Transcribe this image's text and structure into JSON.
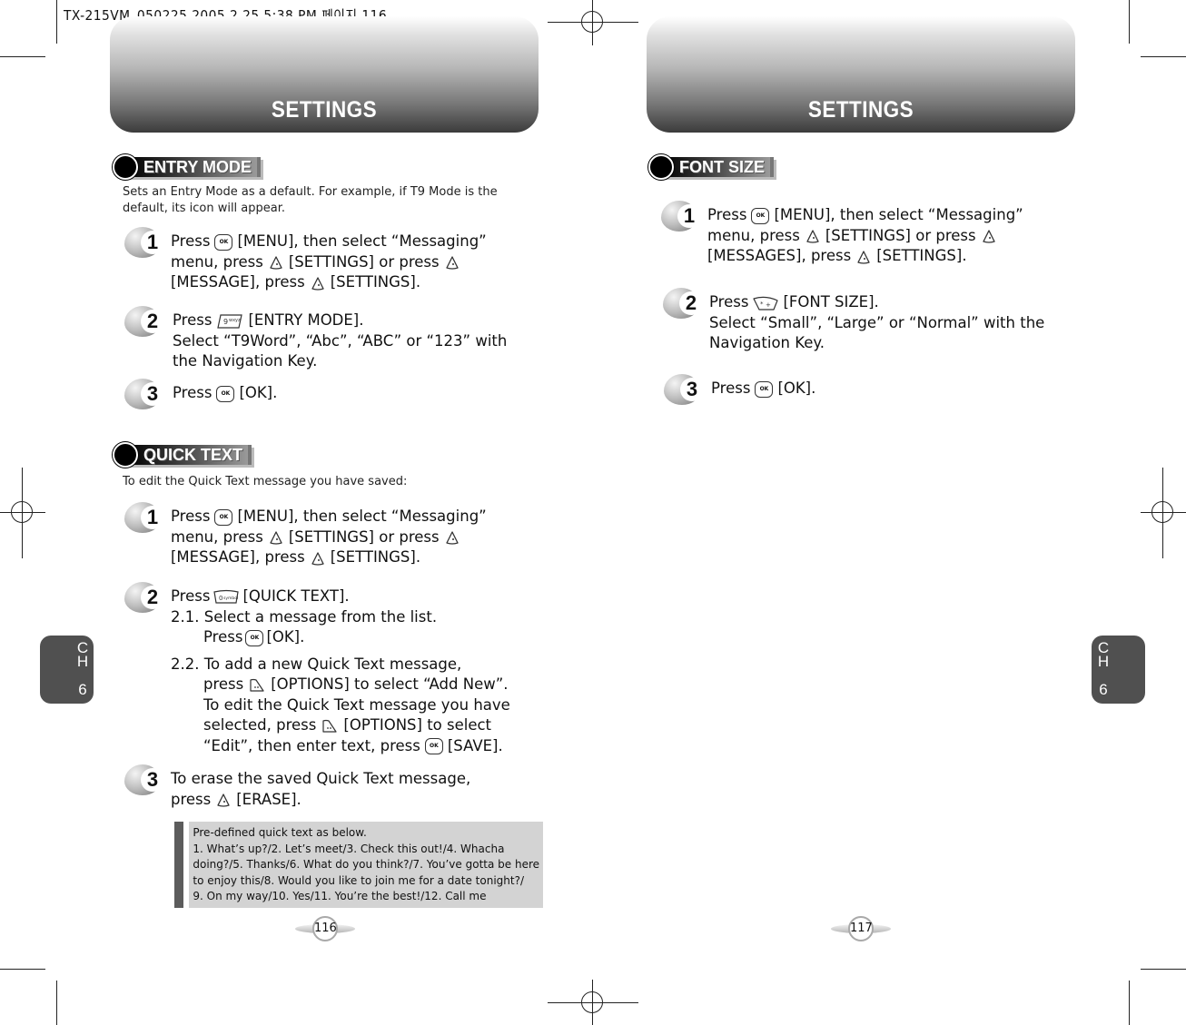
{
  "print_header": "TX-215VM_050225  2005.2.25 5:38 PM 페이지 116",
  "left_page": {
    "header_title": "SETTINGS",
    "chapter_tab": {
      "ch": "CH",
      "number": "6"
    },
    "page_number": "116",
    "sections": [
      {
        "title": "ENTRY MODE",
        "intro": [
          "Sets an Entry Mode as a default. For example, if T9 Mode is the",
          "default, its icon will appear."
        ],
        "steps": [
          {
            "number": "1",
            "lines": [
              [
                "Press",
                "ok-key",
                "[MENU], then select “Messaging”"
              ],
              [
                "menu, press",
                "soft-key",
                "[SETTINGS] or press",
                "soft-key"
              ],
              [
                "[MESSAGE], press",
                "soft-key",
                "[SETTINGS]."
              ]
            ]
          },
          {
            "number": "2",
            "lines": [
              [
                "Press",
                "9-wxyz-key",
                "[ENTRY MODE]."
              ],
              [
                "Select “T9Word”, “Abc”, “ABC” or “123” with"
              ],
              [
                "the Navigation Key."
              ]
            ]
          },
          {
            "number": "3",
            "lines": [
              [
                "Press",
                "ok-key",
                "[OK]."
              ]
            ]
          }
        ]
      },
      {
        "title": "QUICK TEXT",
        "intro": [
          "To edit the Quick Text message you have saved:"
        ],
        "steps": [
          {
            "number": "1",
            "lines": [
              [
                "Press",
                "ok-key",
                "[MENU], then select “Messaging”"
              ],
              [
                "menu, press",
                "soft-key",
                "[SETTINGS] or press",
                "soft-key"
              ],
              [
                "[MESSAGE], press",
                "soft-key",
                "[SETTINGS]."
              ]
            ]
          },
          {
            "number": "2",
            "lines": [
              [
                "Press",
                "0-symbol-key",
                "[QUICK TEXT]."
              ],
              [
                "2.1. Select a message from the list."
              ],
              [
                "Press",
                "ok-key",
                "[OK]."
              ],
              [
                "2.2. To add a new Quick Text message,"
              ],
              [
                "press",
                "options-key",
                "[OPTIONS] to select “Add New”."
              ],
              [
                "To edit the Quick Text message you have"
              ],
              [
                "selected, press",
                "options-key",
                "[OPTIONS] to select"
              ],
              [
                "“Edit”, then enter text, press",
                "ok-key",
                "[SAVE]."
              ]
            ]
          },
          {
            "number": "3",
            "lines": [
              [
                "To erase the saved Quick Text message,"
              ],
              [
                "press",
                "soft-key",
                "[ERASE]."
              ]
            ]
          }
        ],
        "note": [
          "Pre-defined quick text as below.",
          "1. What’s up?/2. Let’s meet/3. Check this out!/4. Whacha",
          "doing?/5. Thanks/6. What do you think?/7. You’ve gotta be here",
          "to enjoy this/8. Would you like to join me for a date tonight?/",
          "9. On my way/10. Yes/11. You’re the best!/12. Call me"
        ]
      }
    ]
  },
  "right_page": {
    "header_title": "SETTINGS",
    "chapter_tab": {
      "ch": "CH",
      "number": "6"
    },
    "page_number": "117",
    "sections": [
      {
        "title": "FONT SIZE",
        "steps": [
          {
            "number": "1",
            "lines": [
              [
                "Press",
                "ok-key",
                "[MENU], then select “Messaging”"
              ],
              [
                "menu, press",
                "soft-key",
                "[SETTINGS] or press",
                "soft-key"
              ],
              [
                "[MESSAGES], press",
                "soft-key",
                "[SETTINGS]."
              ]
            ]
          },
          {
            "number": "2",
            "lines": [
              [
                "Press",
                "star-key",
                "[FONT SIZE]."
              ],
              [
                "Select “Small”, “Large” or “Normal” with the"
              ],
              [
                "Navigation Key."
              ]
            ]
          },
          {
            "number": "3",
            "lines": [
              [
                "Press",
                "ok-key",
                "[OK]."
              ]
            ]
          }
        ]
      }
    ]
  }
}
